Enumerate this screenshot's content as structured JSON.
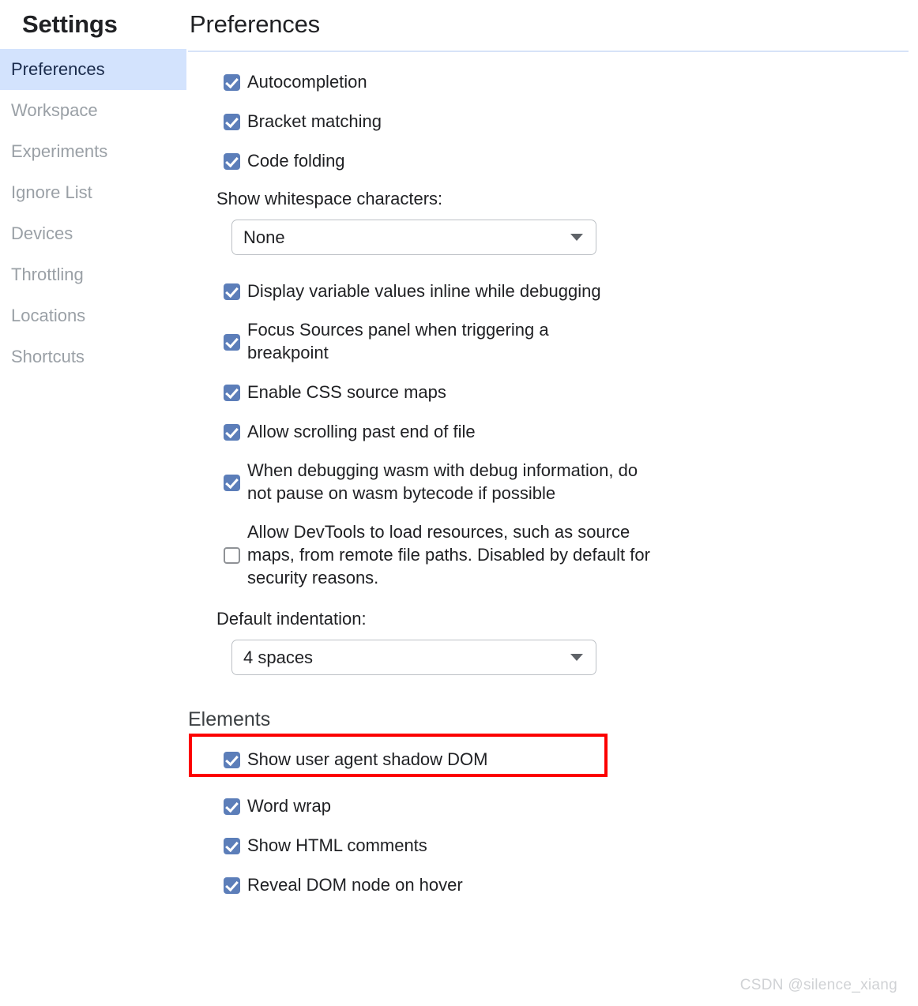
{
  "sidebar": {
    "title": "Settings",
    "items": [
      {
        "label": "Preferences",
        "active": true
      },
      {
        "label": "Workspace",
        "active": false
      },
      {
        "label": "Experiments",
        "active": false
      },
      {
        "label": "Ignore List",
        "active": false
      },
      {
        "label": "Devices",
        "active": false
      },
      {
        "label": "Throttling",
        "active": false
      },
      {
        "label": "Locations",
        "active": false
      },
      {
        "label": "Shortcuts",
        "active": false
      }
    ]
  },
  "main": {
    "title": "Preferences",
    "sources": {
      "checkboxes_top": [
        {
          "label": "Autocompletion",
          "checked": true
        },
        {
          "label": "Bracket matching",
          "checked": true
        },
        {
          "label": "Code folding",
          "checked": true
        }
      ],
      "whitespace": {
        "label": "Show whitespace characters:",
        "value": "None"
      },
      "checkboxes_mid": [
        {
          "label": "Display variable values inline while debugging",
          "checked": true
        },
        {
          "label": "Focus Sources panel when triggering a breakpoint",
          "checked": true
        },
        {
          "label": "Enable CSS source maps",
          "checked": true
        },
        {
          "label": "Allow scrolling past end of file",
          "checked": true
        },
        {
          "label": "When debugging wasm with debug information, do not pause on wasm bytecode if possible",
          "checked": true
        },
        {
          "label": "Allow DevTools to load resources, such as source maps, from remote file paths. Disabled by default for security reasons.",
          "checked": false
        }
      ],
      "indentation": {
        "label": "Default indentation:",
        "value": "4 spaces"
      }
    },
    "elements": {
      "heading": "Elements",
      "checkboxes": [
        {
          "label": "Show user agent shadow DOM",
          "checked": true,
          "highlighted": true
        },
        {
          "label": "Word wrap",
          "checked": true,
          "highlighted": false
        },
        {
          "label": "Show HTML comments",
          "checked": true,
          "highlighted": false
        },
        {
          "label": "Reveal DOM node on hover",
          "checked": true,
          "highlighted": false
        }
      ]
    }
  },
  "watermark": "CSDN @silence_xiang",
  "colors": {
    "accent_checkbox": "#5c7eb9",
    "sidebar_active_bg": "#d3e3fd",
    "sidebar_active_text": "#1a2b4c",
    "sidebar_inactive_text": "#9aa0a6",
    "divider": "#d7e3f8",
    "highlight_outline": "#fc0000",
    "text_primary": "#202124",
    "section_heading": "#3c4043"
  }
}
